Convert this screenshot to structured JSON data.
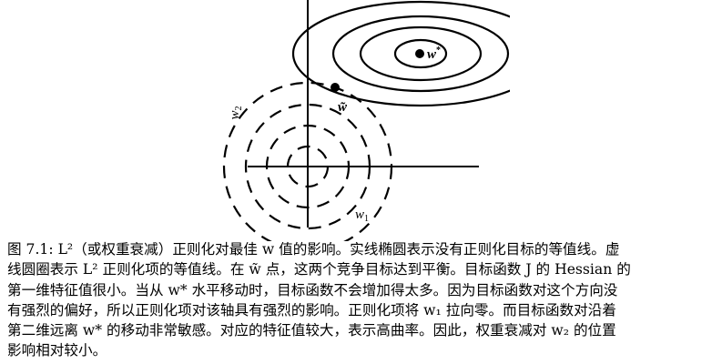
{
  "figure": {
    "x_axis_label": "w",
    "x_axis_sub": "1",
    "y_axis_label": "w",
    "y_axis_sub": "2",
    "optimum_label": "w",
    "optimum_sup": "*",
    "equilibrium_label": "w̃"
  },
  "caption": {
    "label": "图 7.1:",
    "lines": [
      "L²（或权重衰减）正则化对最佳 w 值的影响。实线椭圆表示没有正则化目标的等值线。虚",
      "线圆圈表示 L² 正则化项的等值线。在 w̃ 点，这两个竞争目标达到平衡。目标函数 J 的 Hessian 的",
      "第一维特征值很小。当从 w* 水平移动时，目标函数不会增加得太多。因为目标函数对这个方向没",
      "有强烈的偏好，所以正则化项对该轴具有强烈的影响。正则化项将 w₁ 拉向零。而目标函数对沿着",
      "第二维远离 w* 的移动非常敏感。对应的特征值较大，表示高曲率。因此，权重衰减对 w₂ 的位置",
      "影响相对较小。"
    ]
  }
}
